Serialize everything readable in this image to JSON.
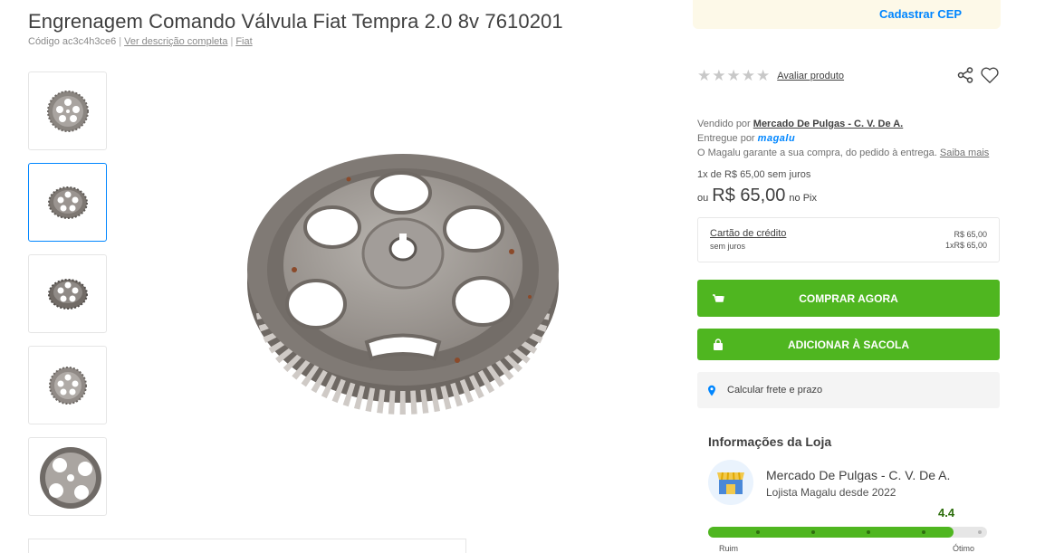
{
  "product": {
    "title": "Engrenagem Comando Válvula Fiat Tempra 2.0 8v 7610201",
    "code": "Código ac3c4h3ce6",
    "description_link": "Ver descrição completa",
    "brand_link": "Fiat"
  },
  "gallery": {
    "thumbnail_count": 5,
    "active_index": 1
  },
  "cep": {
    "link": "Cadastrar CEP"
  },
  "rating": {
    "stars": 0,
    "link": "Avaliar produto"
  },
  "seller": {
    "sold_by_label": "Vendido por",
    "sold_by_name": "Mercado De Pulgas - C. V. De A.",
    "delivered_by_label": "Entregue por",
    "delivered_by_name": "magalu",
    "guarantee_text": "O Magalu garante a sua compra, do pedido à entrega.",
    "learn_more": "Saiba mais"
  },
  "pricing": {
    "installments": "1x de R$ 65,00 sem juros",
    "ou": "ou",
    "pix_price": "R$ 65,00",
    "pix_label": "no Pix"
  },
  "credit_card": {
    "label": "Cartão de crédito",
    "sub": "sem juros",
    "price": "R$ 65,00",
    "installment": "1xR$ 65,00"
  },
  "buttons": {
    "buy": "COMPRAR AGORA",
    "bag": "ADICIONAR À SACOLA"
  },
  "shipping": {
    "label": "Calcular frete e prazo"
  },
  "store": {
    "heading": "Informações da Loja",
    "name": "Mercado De Pulgas - C. V. De A.",
    "since": "Lojista Magalu desde 2022",
    "score": "4.4",
    "score_fraction": 0.88,
    "scale_low": "Ruim",
    "scale_high": "Ótimo"
  },
  "colors": {
    "accent_blue": "#0086ff",
    "button_green": "#4fb620",
    "score_green": "#2e6f0e"
  },
  "icons": [
    "share-icon",
    "heart-icon",
    "cart-icon",
    "bag-icon",
    "location-pin-icon",
    "store-icon"
  ]
}
